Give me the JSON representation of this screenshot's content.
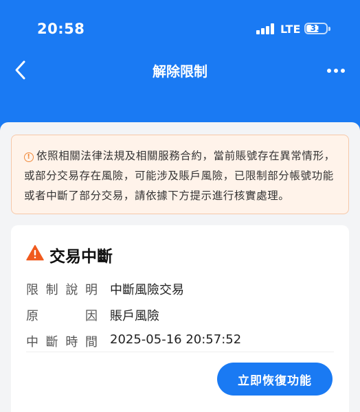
{
  "status_bar": {
    "time": "20:58",
    "network": "LTE",
    "battery_level": "31"
  },
  "nav": {
    "title": "解除限制",
    "back_icon": "chevron-left-icon",
    "more_icon": "more-dots-icon"
  },
  "notice": {
    "icon": "info-circle-icon",
    "text": "依照相關法律法規及相關服務合約，當前賬號存在異常情形，或部分交易存在風險，可能涉及賬戶風險，已限制部分帳號功能或者中斷了部分交易，請依據下方提示進行核實處理。"
  },
  "card": {
    "icon": "warning-triangle-icon",
    "title": "交易中斷",
    "rows": [
      {
        "label": [
          "限",
          "制",
          "說",
          "明"
        ],
        "value": "中斷風險交易"
      },
      {
        "label": [
          "原",
          "因"
        ],
        "value": "賬戶風險"
      },
      {
        "label": [
          "中",
          "斷",
          "時",
          "間"
        ],
        "value": "2025-05-16 20:57:52"
      }
    ],
    "button_label": "立即恢復功能"
  },
  "colors": {
    "primary": "#1a7af3",
    "warning": "#f05a1e",
    "notice_bg": "#fff3ea"
  }
}
